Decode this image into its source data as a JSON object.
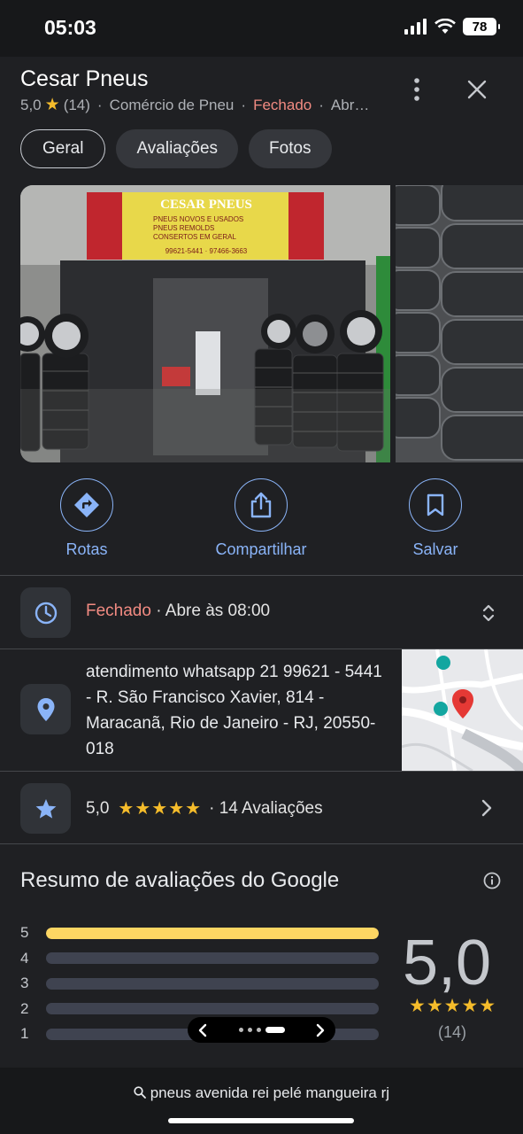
{
  "status_bar": {
    "time": "05:03",
    "battery": "78"
  },
  "place": {
    "name": "Cesar Pneus",
    "rating": "5,0",
    "review_count": "(14)",
    "category": "Comércio de Pneu",
    "status": "Fechado",
    "opens_short": "Abr…"
  },
  "tabs": [
    {
      "label": "Geral",
      "active": true
    },
    {
      "label": "Avaliações",
      "active": false
    },
    {
      "label": "Fotos",
      "active": false
    }
  ],
  "photo_sign": {
    "title": "CESAR PNEUS",
    "lines": [
      "PNEUS NOVOS E USADOS",
      "PNEUS REMOLDS",
      "CONSERTOS EM GERAL"
    ],
    "phones": "99621-5441 · 97466-3663"
  },
  "actions": {
    "directions": "Rotas",
    "share": "Compartilhar",
    "save": "Salvar"
  },
  "hours": {
    "status": "Fechado",
    "separator": " · ",
    "opens": "Abre às 08:00"
  },
  "address": "atendimento whatsapp 21 99621 - 5441 - R. São Francisco Xavier, 814 - Maracanã, Rio de Janeiro - RJ, 20550-018",
  "rating_row": {
    "score": "5,0",
    "stars": "★★★★★",
    "separator": "·",
    "reviews": "14 Avaliações"
  },
  "summary": {
    "title": "Resumo de avaliações do Google",
    "score": "5,0",
    "stars": "★★★★★",
    "count": "(14)",
    "distribution": [
      {
        "label": "5",
        "fraction": 1.0
      },
      {
        "label": "4",
        "fraction": 0
      },
      {
        "label": "3",
        "fraction": 0
      },
      {
        "label": "2",
        "fraction": 0
      },
      {
        "label": "1",
        "fraction": 0
      }
    ]
  },
  "bottom_search": "pneus avenida rei pelé mangueira rj",
  "colors": {
    "accent": "#8ab4f8",
    "closed": "#f28b82",
    "star": "#f5bc2b",
    "bar": "#fdd663"
  }
}
